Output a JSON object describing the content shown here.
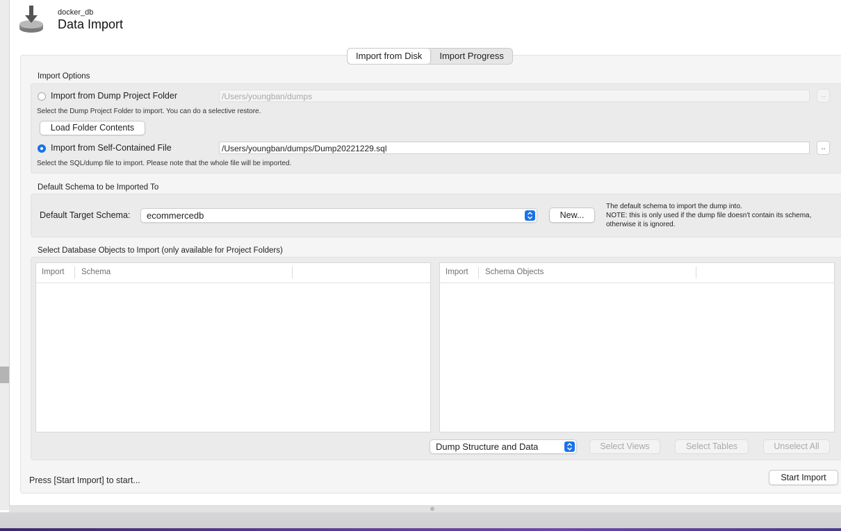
{
  "header": {
    "connection_name": "docker_db",
    "title": "Data Import",
    "icon": "import-disk-icon"
  },
  "tabs": [
    {
      "label": "Import from Disk",
      "active": true
    },
    {
      "label": "Import Progress",
      "active": false
    }
  ],
  "import_options": {
    "section_label": "Import Options",
    "dump_folder": {
      "label": "Import from Dump Project Folder",
      "selected": false,
      "path": "/Users/youngban/dumps",
      "browse_label": "..",
      "hint": "Select the Dump Project Folder to import. You can do a selective restore.",
      "load_button": "Load Folder Contents"
    },
    "self_contained": {
      "label": "Import from Self-Contained File",
      "selected": true,
      "path": "/Users/youngban/dumps/Dump20221229.sql",
      "browse_label": "..",
      "hint": "Select the SQL/dump file to import. Please note that the whole file will be imported."
    }
  },
  "default_schema": {
    "section_label": "Default Schema to be Imported To",
    "target_label": "Default Target Schema:",
    "selected_schema": "ecommercedb",
    "new_button": "New...",
    "note_line1": "The default schema to import the dump into.",
    "note_line2": "NOTE: this is only used if the dump file doesn't contain its schema,",
    "note_line3": "otherwise it is ignored."
  },
  "objects": {
    "section_label": "Select Database Objects to Import (only available for Project Folders)",
    "left_table": {
      "col_import": "Import",
      "col_name": "Schema"
    },
    "right_table": {
      "col_import": "Import",
      "col_name": "Schema Objects"
    },
    "dump_mode": "Dump Structure and Data",
    "select_views": "Select Views",
    "select_tables": "Select Tables",
    "unselect_all": "Unselect All"
  },
  "footer": {
    "status": "Press [Start Import] to start...",
    "start_button": "Start Import"
  },
  "colors": {
    "accent": "#1a73e8",
    "panel": "#f5f5f5",
    "group": "#ebebeb"
  }
}
